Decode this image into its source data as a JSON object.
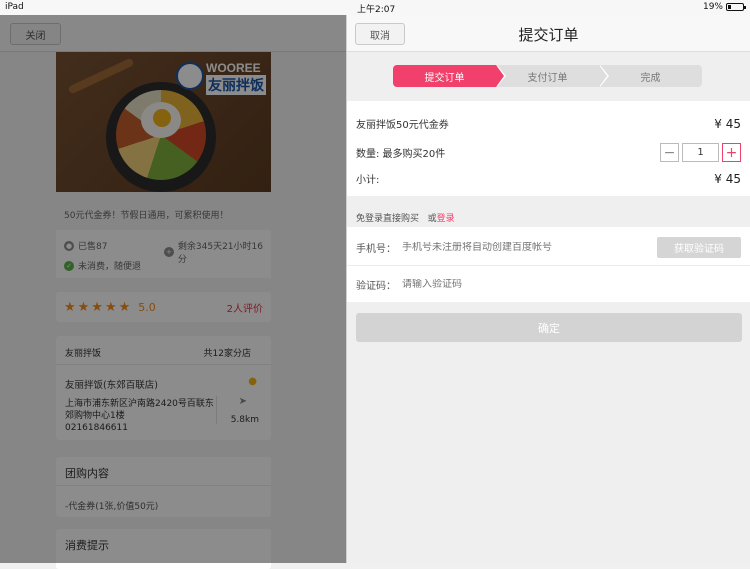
{
  "status_bar": {
    "device": "iPad",
    "time": "上午2:07",
    "battery": "19%",
    "battery_level": 0.19
  },
  "left": {
    "close_label": "关闭",
    "promo_text": "50元代金券！节假日通用，可累积使用！",
    "sold": "已售87",
    "remaining": "剩余345天21小时16分",
    "refund": "未消费，随便退",
    "rating_score": "5.0",
    "review_count": "2人评价",
    "logo_en": "WOOREE",
    "logo_cn": "友丽拌饭",
    "shop_brand": "友丽拌饭",
    "branch_count": "共12家分店",
    "shop_name": "友丽拌饭(东郊百联店)",
    "shop_address": "上海市浦东新区沪南路2420号百联东郊购物中心1楼",
    "shop_phone": "02161846611",
    "distance": "5.8km",
    "group_title": "团购内容",
    "group_item": "-代金券(1张,价值50元)",
    "tips_title": "消费提示"
  },
  "right": {
    "cancel_label": "取消",
    "title": "提交订单",
    "steps": [
      "提交订单",
      "支付订单",
      "完成"
    ],
    "product_name": "友丽拌饭50元代金券",
    "product_price": "¥ 45",
    "quantity_label": "数量: 最多购买20件",
    "quantity_value": "1",
    "minus": "−",
    "plus": "+",
    "subtotal_label": "小计:",
    "subtotal_value": "¥ 45",
    "login_hint": "免登录直接购买",
    "login_or": "或",
    "login_link": "登录",
    "phone_label": "手机号：",
    "phone_placeholder": "手机号未注册将自动创建百度帐号",
    "get_code_label": "获取验证码",
    "code_label": "验证码：",
    "code_placeholder": "请输入验证码",
    "confirm_label": "确定"
  },
  "colors": {
    "accent": "#f0406b",
    "star": "#f28c1e"
  }
}
